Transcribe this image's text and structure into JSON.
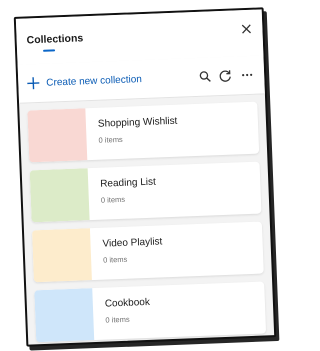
{
  "header": {
    "title": "Collections",
    "close_icon": "close-icon"
  },
  "toolbar": {
    "create_label": "Create new collection",
    "icons": [
      "plus-icon",
      "search-icon",
      "refresh-icon",
      "more-icon"
    ]
  },
  "collections": [
    {
      "name": "Shopping Wishlist",
      "count": "0 items",
      "color": "#f9d8d3"
    },
    {
      "name": "Reading List",
      "count": "0 items",
      "color": "#dcebc8"
    },
    {
      "name": "Video Playlist",
      "count": "0 items",
      "color": "#fdeccc"
    },
    {
      "name": "Cookbook",
      "count": "0 items",
      "color": "#cfe6fa"
    }
  ],
  "colors": {
    "accent": "#0b5cb5",
    "panel_background": "#f3f3f3"
  }
}
